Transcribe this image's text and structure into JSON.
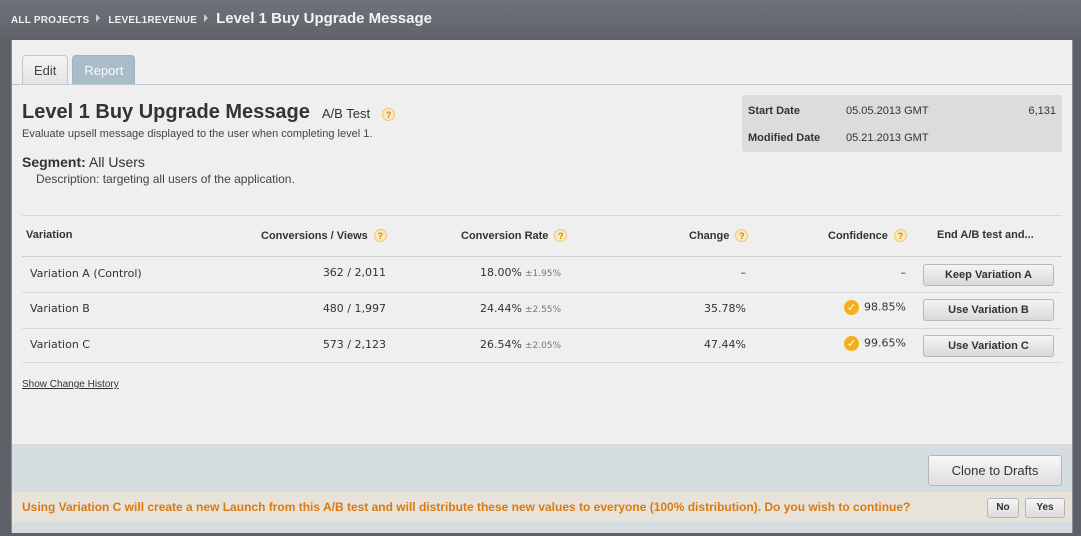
{
  "breadcrumb": {
    "items": [
      "ALL PROJECTS",
      "LEVEL1REVENUE"
    ],
    "current": "Level 1 Buy Upgrade Message"
  },
  "tabs": [
    {
      "label": "Edit",
      "active": false
    },
    {
      "label": "Report",
      "active": true
    }
  ],
  "test": {
    "title": "Level 1 Buy Upgrade Message",
    "type": "A/B Test",
    "subtitle": "Evaluate upsell message displayed to the user when completing level 1.",
    "segment_label": "Segment:",
    "segment_value": "All Users",
    "description": "Description: targeting all users of the application."
  },
  "meta": {
    "start_label": "Start Date",
    "start_value": "05.05.2013 GMT",
    "start_count": "6,131",
    "modified_label": "Modified Date",
    "modified_value": "05.21.2013 GMT"
  },
  "table": {
    "headers": {
      "variation": "Variation",
      "conversions": "Conversions / Views",
      "rate": "Conversion Rate",
      "change": "Change",
      "confidence": "Confidence",
      "end": "End A/B test and..."
    },
    "rows": [
      {
        "name": "Variation A (Control)",
        "conversions": "362 / 2,011",
        "rate": "18.00%",
        "moe": "±1.95%",
        "change": "–",
        "confidence": "–",
        "confident": false,
        "action": "Keep Variation A"
      },
      {
        "name": "Variation B",
        "conversions": "480 / 1,997",
        "rate": "24.44%",
        "moe": "±2.55%",
        "change": "35.78%",
        "confidence": "98.85%",
        "confident": true,
        "action": "Use Variation B"
      },
      {
        "name": "Variation C",
        "conversions": "573 / 2,123",
        "rate": "26.54%",
        "moe": "±2.05%",
        "change": "47.44%",
        "confidence": "99.65%",
        "confident": true,
        "action": "Use Variation C"
      }
    ]
  },
  "history_link": "Show Change History",
  "footer": {
    "clone_label": "Clone to Drafts",
    "confirm_message": "Using Variation C will create a new Launch from this A/B test and will distribute these new values to everyone (100% distribution). Do you wish to continue?",
    "no_label": "No",
    "yes_label": "Yes"
  },
  "icons": {
    "help": "question-mark-icon",
    "check": "checkmark-icon",
    "breadcrumb_sep": "triangle-right-icon"
  },
  "colors": {
    "accent_orange": "#d97a13",
    "help_orange": "#f2b01e",
    "active_tab": "#a9bdc8"
  }
}
